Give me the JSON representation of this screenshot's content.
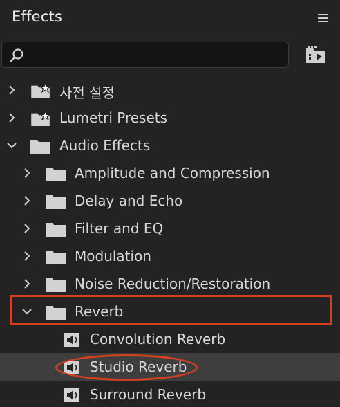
{
  "panel": {
    "title": "Effects"
  },
  "search": {
    "value": "",
    "placeholder": ""
  },
  "tree": [
    {
      "label": "사전 설정",
      "kind": "folder-star",
      "expanded": false,
      "level": 0
    },
    {
      "label": "Lumetri Presets",
      "kind": "folder-star",
      "expanded": false,
      "level": 0
    },
    {
      "label": "Audio Effects",
      "kind": "folder",
      "expanded": true,
      "level": 0
    },
    {
      "label": "Amplitude and Compression",
      "kind": "folder",
      "expanded": false,
      "level": 1
    },
    {
      "label": "Delay and Echo",
      "kind": "folder",
      "expanded": false,
      "level": 1
    },
    {
      "label": "Filter and EQ",
      "kind": "folder",
      "expanded": false,
      "level": 1
    },
    {
      "label": "Modulation",
      "kind": "folder",
      "expanded": false,
      "level": 1
    },
    {
      "label": "Noise Reduction/Restoration",
      "kind": "folder",
      "expanded": false,
      "level": 1
    },
    {
      "label": "Reverb",
      "kind": "folder",
      "expanded": true,
      "level": 1
    },
    {
      "label": "Convolution Reverb",
      "kind": "effect",
      "level": 2
    },
    {
      "label": "Studio Reverb",
      "kind": "effect",
      "level": 2,
      "selected": true
    },
    {
      "label": "Surround Reverb",
      "kind": "effect",
      "level": 2
    }
  ],
  "colors": {
    "background": "#232323",
    "search_bg": "#141414",
    "selected_row": "#3e3e3e",
    "annotation": "#d6401f",
    "text": "#d8d8d8"
  },
  "icons": {
    "menu": "hamburger-icon",
    "search": "search-icon",
    "new_bin": "new-custom-bin-icon",
    "folder": "folder-icon",
    "folder_star": "preset-folder-icon",
    "effect": "audio-effect-icon",
    "collapsed": "chevron-right-icon",
    "expanded": "chevron-down-icon"
  }
}
